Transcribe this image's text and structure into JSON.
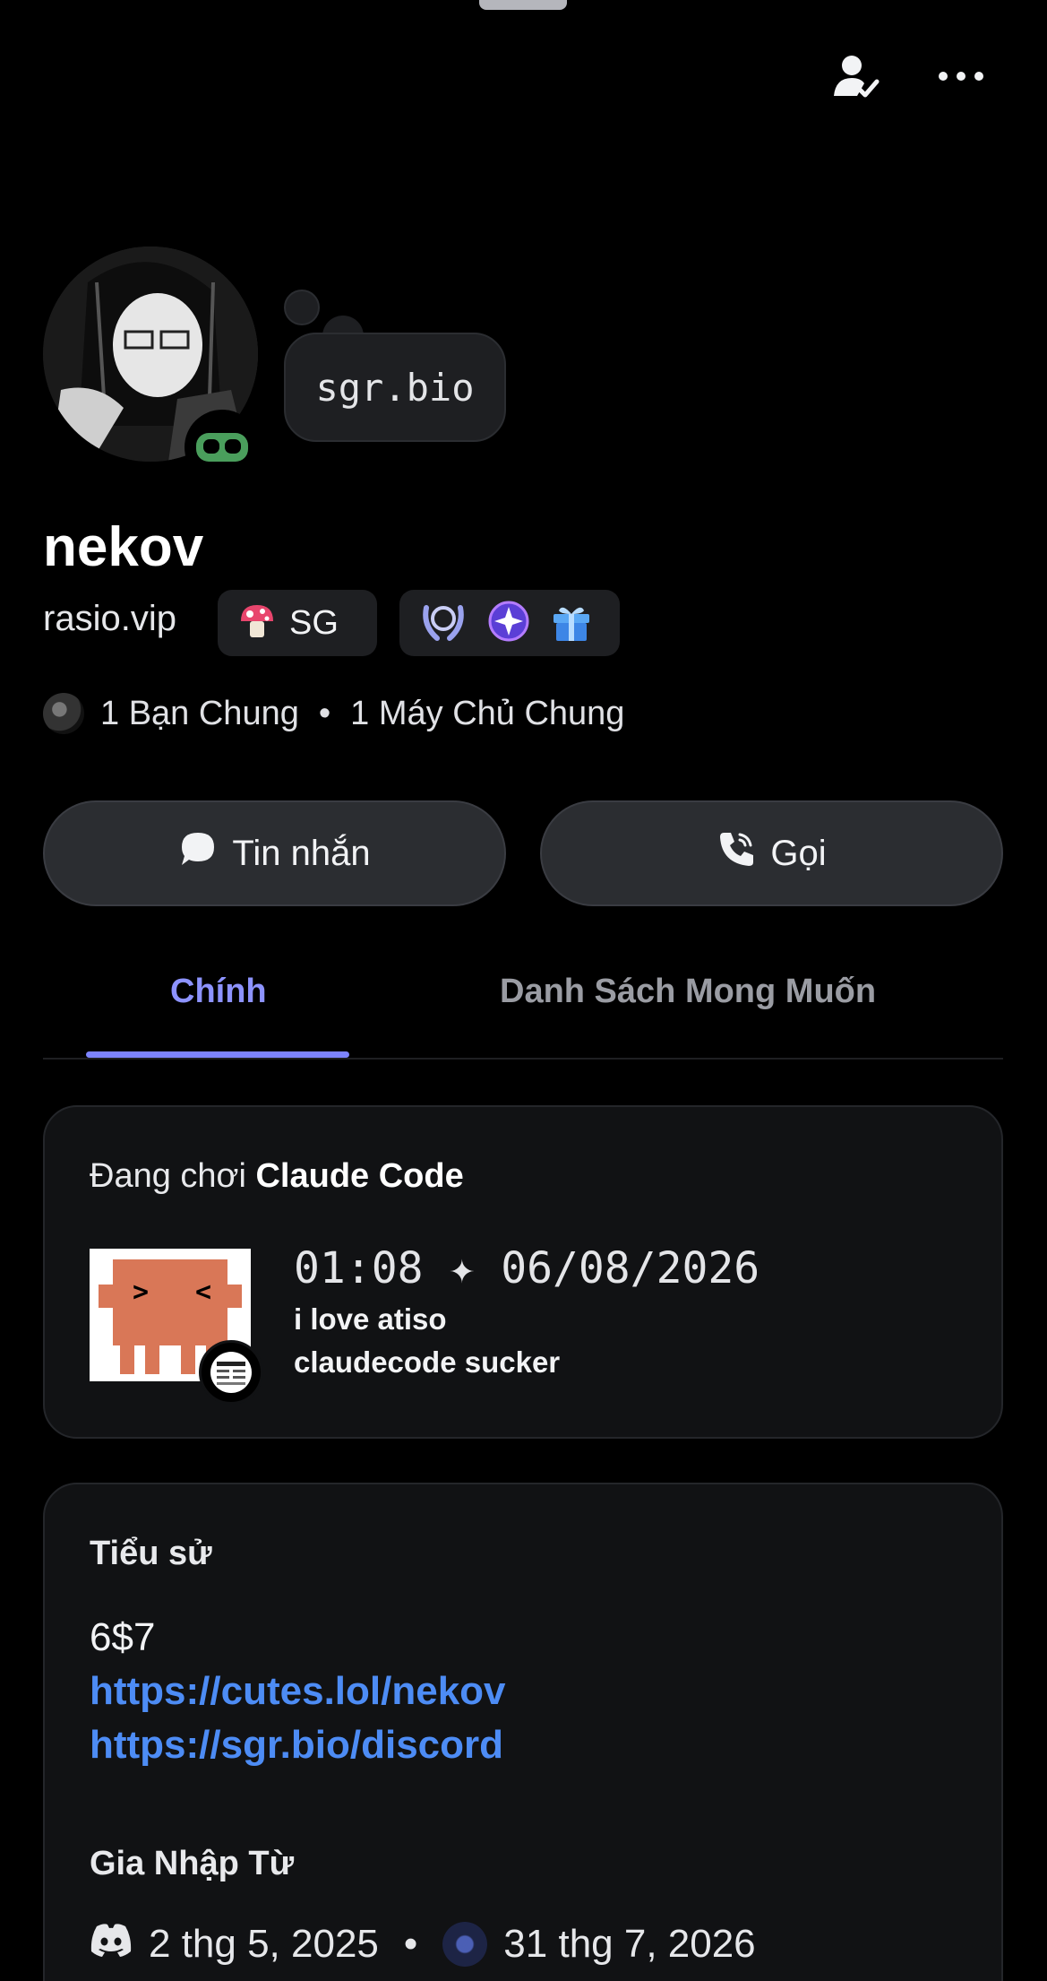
{
  "header": {
    "friend_icon": "user-check-icon",
    "more_icon": "more-horizontal-icon"
  },
  "profile": {
    "status_bubble": "sgr.bio",
    "display_name": "nekov",
    "username": "rasio.vip",
    "tag": {
      "icon": "mushroom-icon",
      "label": "SG"
    },
    "badges": [
      "laurel-badge-icon",
      "quest-badge-icon",
      "gift-badge-icon"
    ],
    "mutual_friends": "1 Bạn Chung",
    "mutual_sep": "•",
    "mutual_servers": "1 Máy Chủ Chung"
  },
  "actions": {
    "message_label": "Tin nhắn",
    "call_label": "Gọi"
  },
  "tabs": [
    {
      "label": "Chính",
      "active": true
    },
    {
      "label": "Danh Sách Mong Muốn",
      "active": false
    }
  ],
  "activity": {
    "prefix": "Đang chơi ",
    "game": "Claude Code",
    "time": "01:08 ✦ 06/08/2026",
    "line1": "i love atiso",
    "line2": "claudecode sucker"
  },
  "bio": {
    "heading": "Tiểu sử",
    "text": "6$7",
    "link1": "https://cutes.lol/nekov",
    "link2": "https://sgr.bio/discord"
  },
  "joined": {
    "heading": "Gia Nhập Từ",
    "discord_date": "2 thg 5, 2025",
    "sep": "•",
    "server_date": "31 thg 7, 2026"
  },
  "colors": {
    "accent": "#7d84ff",
    "link": "#4d8cf5",
    "status": "#4a9e5c",
    "mascot": "#d97757"
  }
}
